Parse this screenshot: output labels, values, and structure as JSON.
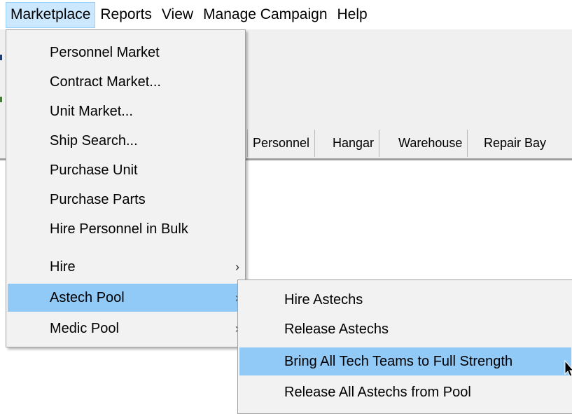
{
  "menubar": {
    "items": [
      "Marketplace",
      "Reports",
      "View",
      "Manage Campaign",
      "Help"
    ],
    "active": "Marketplace"
  },
  "tabs": [
    "Personnel",
    "Hangar",
    "Warehouse",
    "Repair Bay"
  ],
  "marketplace_menu": {
    "items": [
      {
        "label": "Personnel Market"
      },
      {
        "label": "Contract Market..."
      },
      {
        "label": "Unit Market..."
      },
      {
        "label": "Ship Search..."
      },
      {
        "label": "Purchase Unit"
      },
      {
        "label": "Purchase Parts"
      },
      {
        "label": "Hire Personnel in Bulk"
      },
      {
        "label": "Hire",
        "submenu": true
      },
      {
        "label": "Astech Pool",
        "submenu": true,
        "highlighted": true
      },
      {
        "label": "Medic Pool",
        "submenu": true
      }
    ]
  },
  "astech_submenu": {
    "items": [
      {
        "label": "Hire Astechs"
      },
      {
        "label": "Release Astechs"
      },
      {
        "label": "Bring All Tech Teams to Full Strength",
        "highlighted": true
      },
      {
        "label": "Release All Astechs from Pool"
      }
    ]
  },
  "colors": {
    "highlight": "#91c9f7",
    "menubar_active": "#cce8ff",
    "menu_bg": "#f2f2f2"
  },
  "icons": {
    "submenu_arrow": "chevron-right-icon",
    "cursor": "mouse-pointer-icon"
  }
}
